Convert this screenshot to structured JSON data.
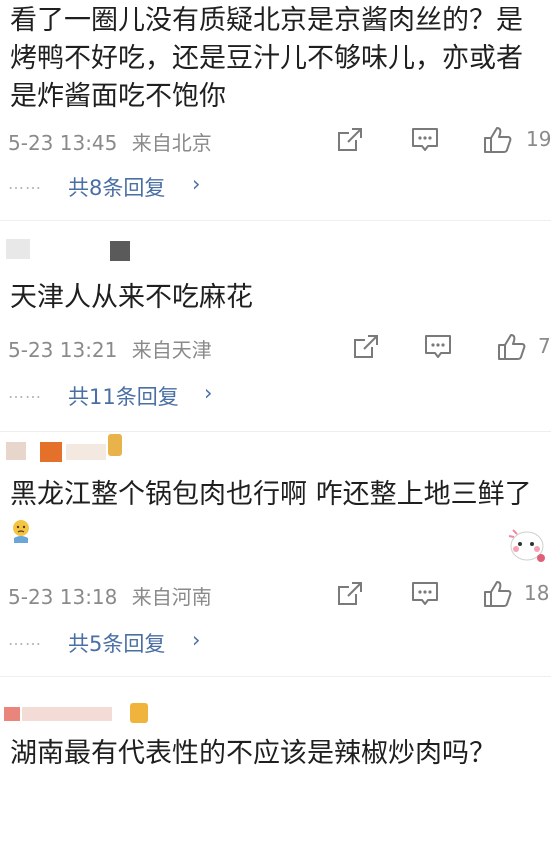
{
  "comments": [
    {
      "text": "看了一圈儿没有质疑北京是京酱肉丝的？是烤鸭不好吃，还是豆汁儿不够味儿，亦或者是炸酱面吃不饱你",
      "time": "5-23 13:45",
      "location": "来自北京",
      "likes": "19",
      "replies": "共8条回复",
      "chevron": "›"
    },
    {
      "text": "天津人从来不吃麻花",
      "time": "5-23 13:21",
      "location": "来自天津",
      "likes": "7",
      "replies": "共11条回复",
      "chevron": "›"
    },
    {
      "text": "黑龙江整个锅包肉也行啊 咋还整上地三鲜了",
      "time": "5-23 13:18",
      "location": "来自河南",
      "likes": "18",
      "replies": "共5条回复",
      "chevron": "›"
    },
    {
      "text": "湖南最有代表性的不应该是辣椒炒肉吗？"
    }
  ],
  "dots": "……",
  "icons": {
    "share": "share-out-icon",
    "comment": "comment-bubble-icon",
    "like": "thumbs-up-icon",
    "emoji": "cry-face-emoji-icon"
  },
  "colors": {
    "text": "#1f1f1f",
    "meta": "#8a8a8a",
    "link": "#4a6fa5",
    "icon": "#7a7a7a"
  }
}
